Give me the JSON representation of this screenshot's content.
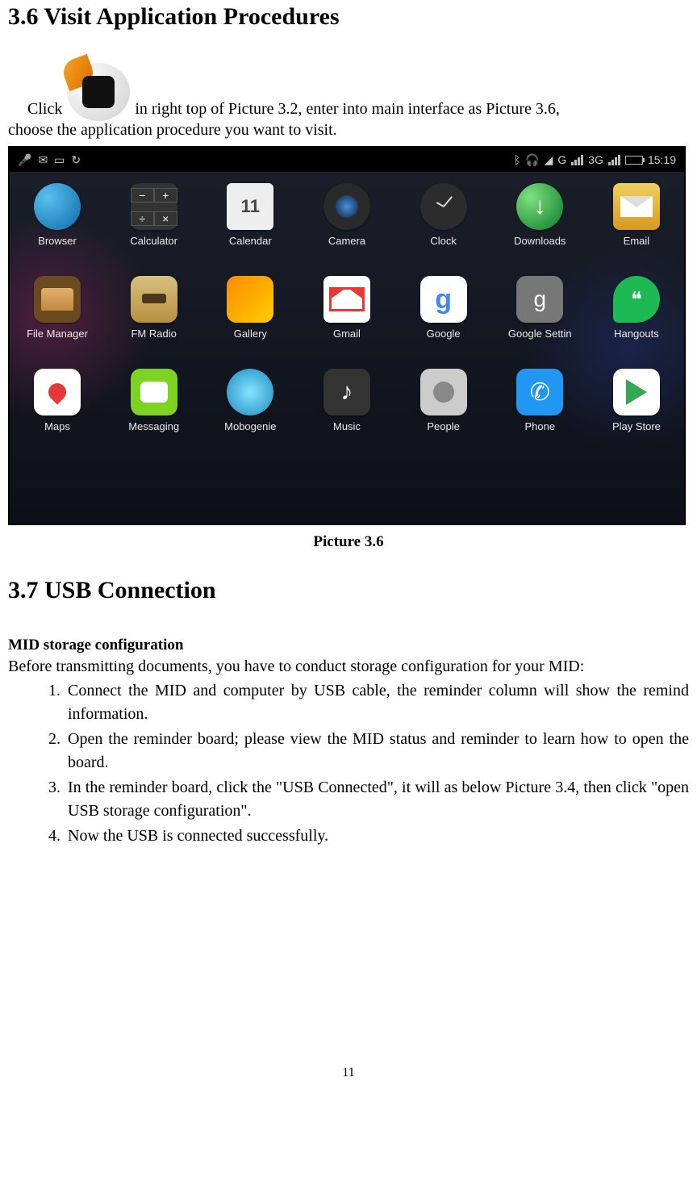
{
  "sections": {
    "s36_title": "3.6 Visit Application Procedures",
    "s37_title": "3.7 USB Connection"
  },
  "intro": {
    "click": "Click",
    "rest": "in right top of Picture 3.2, enter into main interface as Picture 3.6,",
    "line2": "choose the application procedure you want to visit."
  },
  "caption": "Picture 3.6",
  "usb": {
    "subhead": "MID storage configuration",
    "pre": "Before transmitting documents, you have to conduct storage configuration for your MID:",
    "steps": [
      "Connect the MID and computer by USB cable, the reminder column will show the remind information.",
      "Open the reminder board; please view the MID status and reminder to learn how to open the board.",
      "In the reminder board, click the \"USB Connected\", it will as below Picture 3.4, then click \"open USB storage configuration\".",
      "Now the USB is connected successfully."
    ]
  },
  "statusbar": {
    "net_label_g": "G",
    "net_label_3g": "3G",
    "time": "15:19"
  },
  "apps": [
    [
      {
        "label": "Browser",
        "icon": "browser"
      },
      {
        "label": "Calculator",
        "icon": "calculator"
      },
      {
        "label": "Calendar",
        "icon": "calendar",
        "text": "11"
      },
      {
        "label": "Camera",
        "icon": "camera"
      },
      {
        "label": "Clock",
        "icon": "clock"
      },
      {
        "label": "Downloads",
        "icon": "downloads",
        "text": "↓"
      },
      {
        "label": "Email",
        "icon": "email"
      }
    ],
    [
      {
        "label": "File Manager",
        "icon": "filemgr"
      },
      {
        "label": "FM Radio",
        "icon": "fmradio"
      },
      {
        "label": "Gallery",
        "icon": "gallery"
      },
      {
        "label": "Gmail",
        "icon": "gmail"
      },
      {
        "label": "Google",
        "icon": "google",
        "text": "g"
      },
      {
        "label": "Google Settin",
        "icon": "gsettings",
        "text": "g"
      },
      {
        "label": "Hangouts",
        "icon": "hangouts",
        "text": "❝"
      }
    ],
    [
      {
        "label": "Maps",
        "icon": "maps"
      },
      {
        "label": "Messaging",
        "icon": "messaging"
      },
      {
        "label": "Mobogenie",
        "icon": "mobogenie"
      },
      {
        "label": "Music",
        "icon": "music",
        "text": "♪"
      },
      {
        "label": "People",
        "icon": "people"
      },
      {
        "label": "Phone",
        "icon": "phone",
        "text": "✆"
      },
      {
        "label": "Play Store",
        "icon": "play"
      }
    ]
  ],
  "page_number": "11"
}
